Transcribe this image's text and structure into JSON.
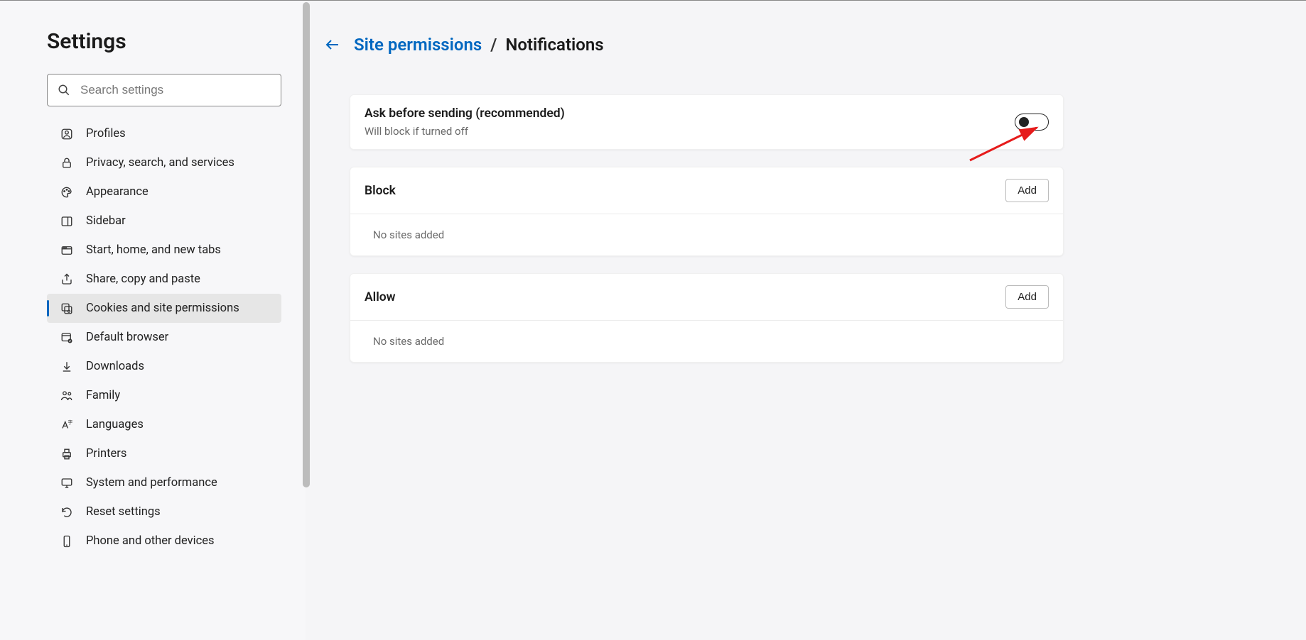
{
  "sidebar": {
    "title": "Settings",
    "search_placeholder": "Search settings",
    "items": [
      {
        "label": "Profiles"
      },
      {
        "label": "Privacy, search, and services"
      },
      {
        "label": "Appearance"
      },
      {
        "label": "Sidebar"
      },
      {
        "label": "Start, home, and new tabs"
      },
      {
        "label": "Share, copy and paste"
      },
      {
        "label": "Cookies and site permissions"
      },
      {
        "label": "Default browser"
      },
      {
        "label": "Downloads"
      },
      {
        "label": "Family"
      },
      {
        "label": "Languages"
      },
      {
        "label": "Printers"
      },
      {
        "label": "System and performance"
      },
      {
        "label": "Reset settings"
      },
      {
        "label": "Phone and other devices"
      }
    ],
    "active_index": 6
  },
  "breadcrumb": {
    "link": "Site permissions",
    "sep": "/",
    "current": "Notifications"
  },
  "ask_card": {
    "title": "Ask before sending (recommended)",
    "sub": "Will block if turned off",
    "toggle_on": false
  },
  "block_card": {
    "title": "Block",
    "add_label": "Add",
    "empty": "No sites added"
  },
  "allow_card": {
    "title": "Allow",
    "add_label": "Add",
    "empty": "No sites added"
  }
}
